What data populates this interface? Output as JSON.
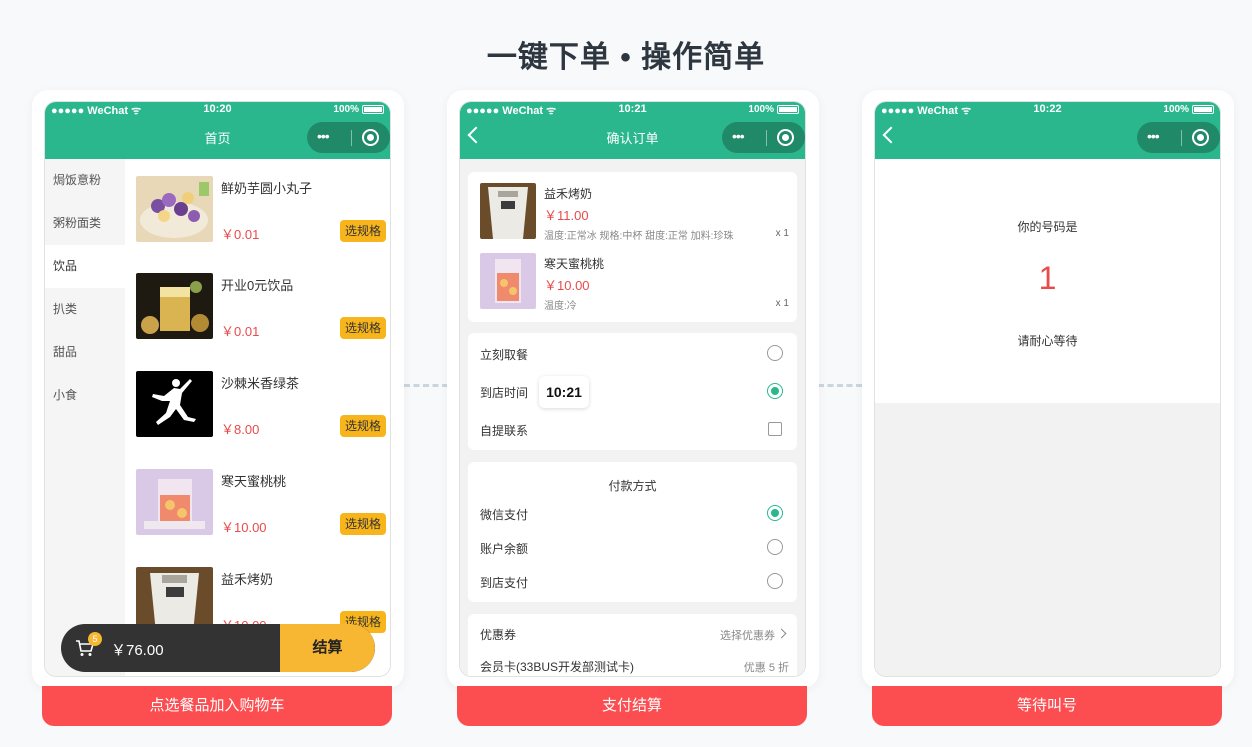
{
  "page": {
    "title": "一键下单 • 操作简单",
    "captions": [
      "点选餐品加入购物车",
      "支付结算",
      "等待叫号"
    ]
  },
  "status": {
    "carrier": "●●●●● WeChat",
    "battery": "100%",
    "times": [
      "10:20",
      "10:21",
      "10:22"
    ]
  },
  "phone1": {
    "nav_title": "首页",
    "categories": [
      "焗饭意粉",
      "粥粉面类",
      "饮品",
      "扒类",
      "甜品",
      "小食"
    ],
    "active_category": "饮品",
    "products": [
      {
        "name": "鲜奶芋圆小丸子",
        "price": "￥0.01",
        "button": "选规格"
      },
      {
        "name": "开业0元饮品",
        "price": "￥0.01",
        "button": "选规格"
      },
      {
        "name": "沙棘米香绿茶",
        "price": "￥8.00",
        "button": "选规格"
      },
      {
        "name": "寒天蜜桃桃",
        "price": "￥10.00",
        "button": "选规格"
      },
      {
        "name": "益禾烤奶",
        "price": "￥10.00",
        "button": "选规格"
      }
    ],
    "cart": {
      "badge": "5",
      "total": "￥76.00",
      "checkout": "结算"
    }
  },
  "phone2": {
    "nav_title": "确认订单",
    "items": [
      {
        "name": "益禾烤奶",
        "price": "￥11.00",
        "attrs": "温度:正常冰 规格:中杯 甜度:正常 加料:珍珠",
        "qty": "x 1"
      },
      {
        "name": "寒天蜜桃桃",
        "price": "￥10.00",
        "attrs": "温度:冷",
        "qty": "x 1"
      }
    ],
    "pickup": {
      "options": [
        "立刻取餐",
        "到店时间",
        "自提联系"
      ],
      "time": "10:21",
      "selected": "到店时间"
    },
    "payment": {
      "title": "付款方式",
      "options": [
        "微信支付",
        "账户余额",
        "到店支付"
      ],
      "selected": "微信支付"
    },
    "coupon": {
      "label": "优惠券",
      "action": "选择优惠券"
    },
    "member": {
      "label": "会员卡(33BUS开发部测试卡)",
      "discount": "优惠 5 折"
    }
  },
  "phone3": {
    "line1": "你的号码是",
    "number": "1",
    "line2": "请耐心等待"
  },
  "colors": {
    "header_green": "#2ab78e",
    "price_red": "#e94b4b",
    "caption_red": "#fc4d50",
    "button_yellow": "#f7b51b"
  }
}
